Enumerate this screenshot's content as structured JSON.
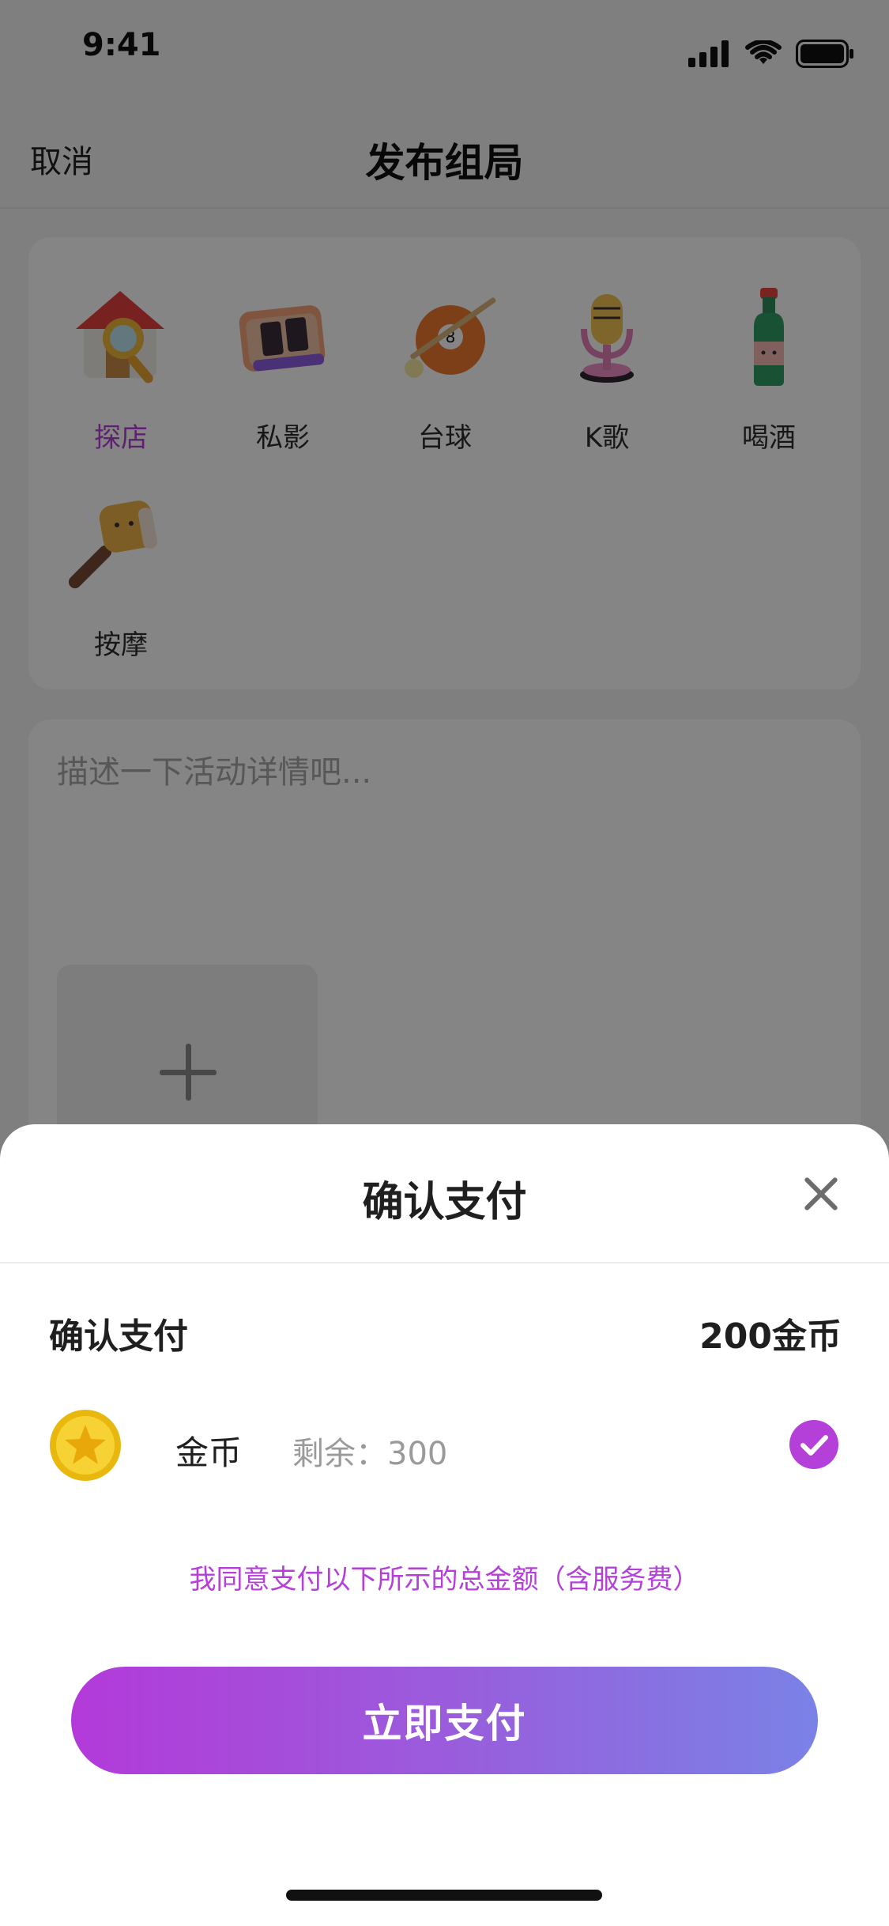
{
  "status_bar": {
    "time": "9:41",
    "icons": [
      "signal-icon",
      "wifi-icon",
      "battery-icon"
    ]
  },
  "nav": {
    "cancel_label": "取消",
    "title": "发布组局"
  },
  "categories": [
    {
      "label": "探店",
      "icon": "shop-explore-icon",
      "active": true
    },
    {
      "label": "私影",
      "icon": "private-cinema-icon",
      "active": false
    },
    {
      "label": "台球",
      "icon": "billiards-icon",
      "active": false
    },
    {
      "label": "K歌",
      "icon": "karaoke-mic-icon",
      "active": false
    },
    {
      "label": "喝酒",
      "icon": "drink-bottle-icon",
      "active": false
    },
    {
      "label": "按摩",
      "icon": "massage-hammer-icon",
      "active": false
    }
  ],
  "description": {
    "placeholder": "描述一下活动详情吧..."
  },
  "sheet": {
    "title": "确认支付",
    "pay_label": "确认支付",
    "pay_amount": "200金币",
    "coin_label": "金币",
    "coin_remaining": "剩余：300",
    "agree_text": "我同意支付以下所示的总金额（含服务费）",
    "pay_button_label": "立即支付"
  },
  "colors": {
    "accent": "#b53fd9",
    "button_gradient_start": "#b33ad9",
    "button_gradient_end": "#7a82e6",
    "overlay": "#000000"
  }
}
